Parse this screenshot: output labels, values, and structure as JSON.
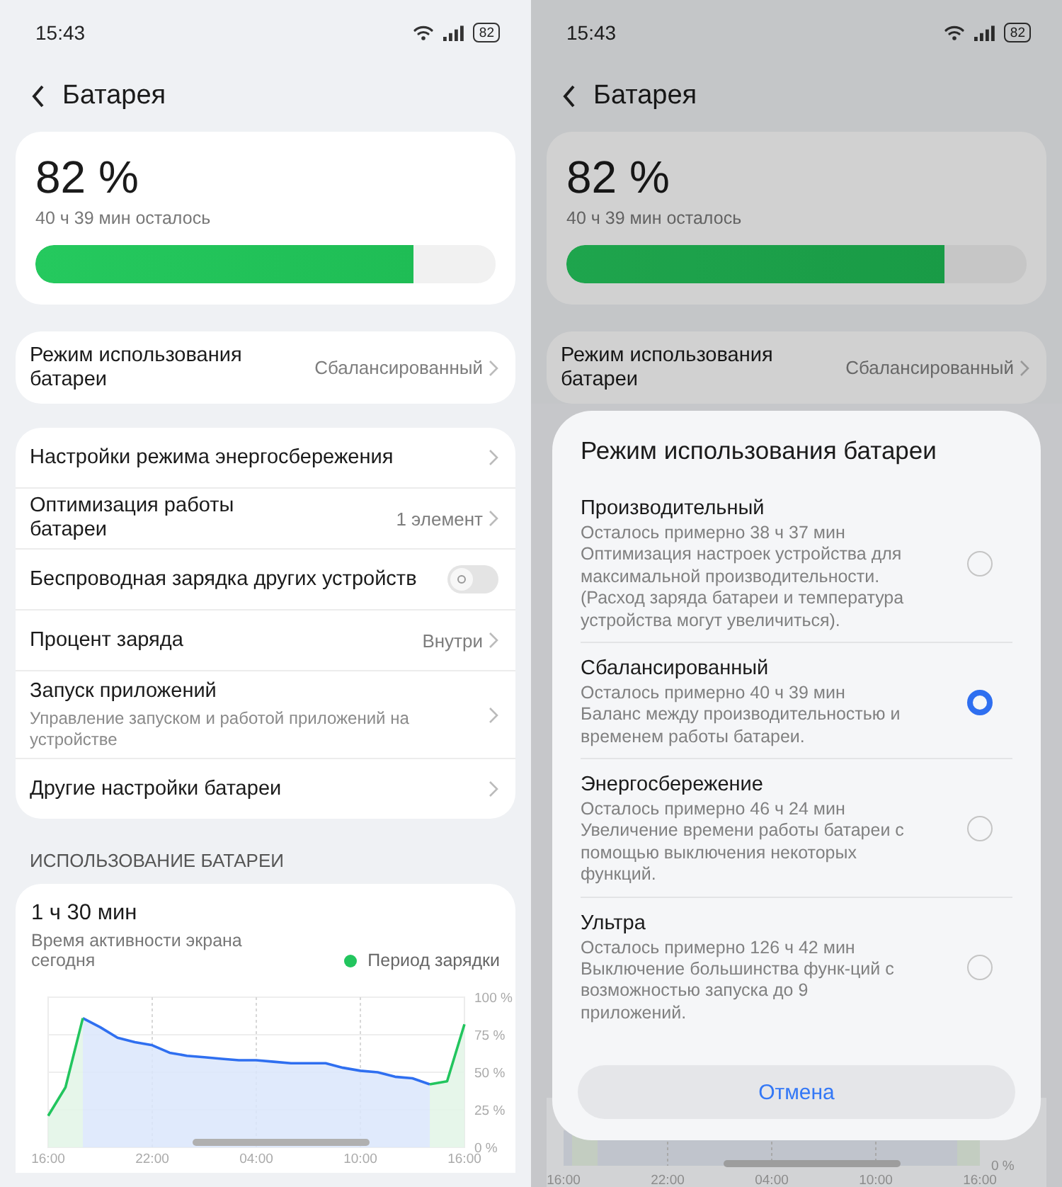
{
  "screens": [
    {
      "kind": "page",
      "status_bar": {
        "time": "15:43",
        "battery": "82"
      },
      "title": "Батарея",
      "battery": {
        "percent": "82 %",
        "remaining": "40 ч 39 мин осталось",
        "level": 0.82
      },
      "mode_row": {
        "title": "Режим использования батареи",
        "value": "Сбалансированный"
      },
      "settings": [
        {
          "kind": "link",
          "title": "Настройки режима энергосбережения"
        },
        {
          "kind": "link",
          "title": "Оптимизация работы батареи",
          "value": "1 элемент"
        },
        {
          "kind": "toggle",
          "title": "Беспроводная зарядка других устройств",
          "on": false
        },
        {
          "kind": "link",
          "title": "Процент заряда",
          "value": "Внутри"
        },
        {
          "kind": "link",
          "title": "Запуск приложений",
          "subtitle": "Управление запуском и работой приложений на устройстве"
        },
        {
          "kind": "link",
          "title": "Другие настройки батареи"
        }
      ],
      "usage": {
        "heading": "ИСПОЛЬЗОВАНИЕ БАТАРЕИ",
        "screen_time": "1 ч 30 мин",
        "screen_time_label": "Время активности экрана сегодня",
        "chart_data": {
          "type": "area",
          "categories": [
            "16:00",
            null,
            null,
            null,
            null,
            null,
            "22:00",
            null,
            null,
            null,
            null,
            null,
            "04:00",
            null,
            null,
            null,
            null,
            null,
            "10:00",
            null,
            null,
            null,
            null,
            null,
            "16:00"
          ],
          "series": [
            {
              "color": "#2f6ff0",
              "values": [
                null,
                null,
                86,
                80,
                73,
                70,
                68,
                63,
                61,
                60,
                59,
                58,
                58,
                57,
                56,
                56,
                56,
                53,
                51,
                50,
                47,
                46,
                42,
                null,
                null
              ]
            },
            {
              "name": "Период зарядки",
              "color": "#22c55e",
              "values": [
                21,
                40,
                86,
                null,
                null,
                null,
                null,
                null,
                null,
                null,
                null,
                null,
                null,
                null,
                null,
                null,
                null,
                null,
                null,
                null,
                null,
                null,
                42,
                44,
                82
              ]
            }
          ],
          "ylim": [
            0,
            100
          ],
          "grid": true,
          "yticks": [
            {
              "value": 0,
              "label": "0 %"
            },
            {
              "value": 25,
              "label": "25 %"
            },
            {
              "value": 50,
              "label": "50 %"
            },
            {
              "value": 75,
              "label": "75 %"
            },
            {
              "value": 100,
              "label": "100 %"
            }
          ]
        }
      }
    },
    {
      "kind": "dialog",
      "status_bar": {
        "time": "15:43",
        "battery": "82"
      },
      "title": "Батарея",
      "battery": {
        "percent": "82 %",
        "remaining": "40 ч 39 мин осталось",
        "level": 0.82
      },
      "mode_row": {
        "title": "Режим использования батареи",
        "value": "Сбалансированный"
      },
      "dialog": {
        "title": "Режим использования батареи",
        "options": [
          {
            "name": "Производительный",
            "remaining": "Осталось примерно 38 ч 37 мин",
            "description": "Оптимизация настроек устройства для максимальной производительности. (Расход заряда батареи и температура устройства могут увеличиться).",
            "selected": false
          },
          {
            "name": "Сбалансированный",
            "remaining": "Осталось примерно 40 ч 39 мин",
            "description": "Баланс между производительностью и временем работы батареи.",
            "selected": true
          },
          {
            "name": "Энергосбережение",
            "remaining": "Осталось примерно 46 ч 24 мин",
            "description": "Увеличение времени работы батареи с помощью выключения некоторых функций.",
            "selected": false
          },
          {
            "name": "Ультра",
            "remaining": "Осталось примерно 126 ч 42 мин",
            "description": "Выключение большинства функ-ций с возможностью запуска до 9 приложений.",
            "selected": false
          }
        ],
        "cancel": "Отмена"
      },
      "chart_fragment": {
        "ytick": "0 %",
        "xticks": [
          "16:00",
          "22:00",
          "04:00",
          "10:00",
          "16:00"
        ]
      }
    }
  ]
}
